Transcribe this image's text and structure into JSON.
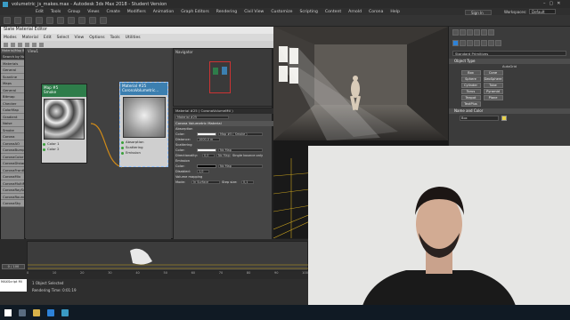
{
  "window": {
    "title": "volumetric_js_makes.max - Autodesk 3ds Max 2018 - Student Version",
    "menu": [
      "Edit",
      "Tools",
      "Group",
      "Views",
      "Create",
      "Modifiers",
      "Animation",
      "Graph Editors",
      "Rendering",
      "Civil View",
      "Customize",
      "Scripting",
      "Content",
      "Arnold",
      "Corona",
      "Help"
    ],
    "sign_in": "Sign In",
    "workspaces_label": "Workspaces:",
    "workspace_value": "Default"
  },
  "slate": {
    "title": "Slate Material Editor",
    "menu": [
      "Modes",
      "Material",
      "Edit",
      "Select",
      "View",
      "Options",
      "Tools",
      "Utilities"
    ],
    "browser_label": "Material/Map Browser",
    "browser_items": [
      "Search by Name",
      "Materials",
      "General",
      "Scanline",
      "Maps",
      "General",
      "Bitmap",
      "Checker",
      "ColorMap",
      "Gradient",
      "Noise",
      "Smoke",
      "Corona",
      "CoronaAO",
      "CoronaBumpConv",
      "CoronaColor",
      "CoronaDistance",
      "CoronaFrontBack",
      "CoronaMix",
      "CoronaMultiMap",
      "CoronaRaySwitch",
      "CoronaRoundEdges",
      "CoronaSky"
    ],
    "view_label": "View1",
    "map_node": {
      "header": "Map #5",
      "sub": "Smoke",
      "ports": [
        "Color 1",
        "Color 2"
      ]
    },
    "mat_node": {
      "header": "Material #25",
      "sub": "CoronaVolumetric...",
      "ports": [
        "Absorption",
        "Scattering",
        "Emission"
      ]
    },
    "navigator_label": "Navigator",
    "params": {
      "title": "Material #25  ( CoronaVolumeMtl )",
      "name": "Material #25",
      "rollout": "Corona Volumetric Material",
      "absorption_label": "Absorption",
      "color_label": "Color:",
      "map_value": "Map #5 ( Smoke )",
      "distance_label": "Distance:",
      "distance_value": "1000,0 m",
      "scattering_label": "Scattering",
      "directionality_label": "Directionality:",
      "directionality_value": "0,0",
      "single_bounce": "Single bounce only",
      "emission_label": "Emission",
      "disabled_label": "Disabled:",
      "disabled_value": "1,0",
      "volume_label": "Volume mapping",
      "mode_label": "Mode:",
      "mode_value": "In Surface",
      "step_label": "Step size:",
      "step_value": "0,1",
      "no_map": "No Map"
    }
  },
  "viewport": {
    "label": "[+] [Camera001] [Standard] [Default Shading]"
  },
  "cmd": {
    "dropdown": "Standard Primitives",
    "object_type": "Object Type",
    "autogrid": "AutoGrid",
    "buttons": [
      "Box",
      "Cone",
      "Sphere",
      "GeoSphere",
      "Cylinder",
      "Tube",
      "Torus",
      "Pyramid",
      "Teapot",
      "Plane",
      "TextPlus"
    ],
    "name_color": "Name and Color",
    "name_value": "Box"
  },
  "timeline": {
    "frame": "0 / 100",
    "frames": [
      "0",
      "10",
      "20",
      "30",
      "40",
      "50",
      "60",
      "70",
      "80",
      "90",
      "100"
    ]
  },
  "status": {
    "selected": "1 Object Selected",
    "render_time": "Rendering Time: 0:01:19",
    "mini": "MAXScript Mi"
  },
  "colors": {
    "map_header": "#2e7d4a",
    "mat_header": "#3c7fb0",
    "accent": "#2d82d8"
  }
}
